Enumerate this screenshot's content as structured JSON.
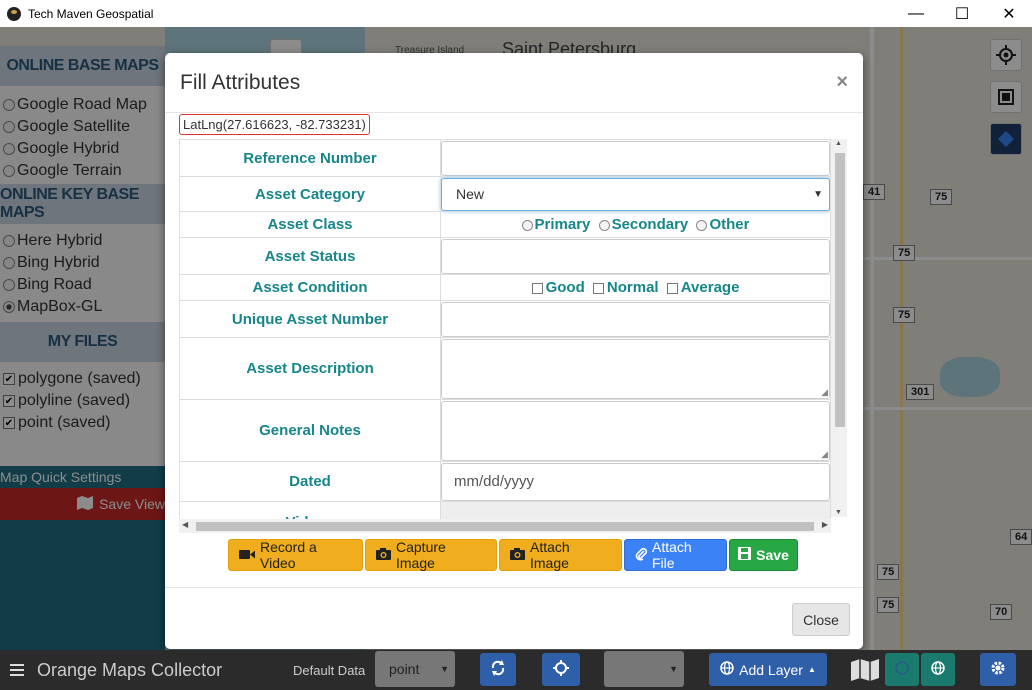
{
  "window": {
    "title": "Tech Maven Geospatial",
    "minimize_glyph": "—",
    "maximize_glyph": "☐",
    "close_glyph": "✕"
  },
  "map": {
    "labels": [
      "Treasure Island",
      "Saint Petersburg"
    ],
    "shields": [
      "41",
      "75",
      "75",
      "75",
      "301",
      "64",
      "75",
      "75",
      "70"
    ]
  },
  "left_panel": {
    "online_base_maps_header": "ONLINE BASE MAPS",
    "base_maps": [
      {
        "label": "Google Road Map",
        "selected": false
      },
      {
        "label": "Google Satellite",
        "selected": false
      },
      {
        "label": "Google Hybrid",
        "selected": false
      },
      {
        "label": "Google Terrain",
        "selected": false
      }
    ],
    "online_key_header": "ONLINE KEY BASE MAPS",
    "key_maps": [
      {
        "label": "Here Hybrid",
        "selected": false
      },
      {
        "label": "Bing Hybrid",
        "selected": false
      },
      {
        "label": "Bing Road",
        "selected": false
      },
      {
        "label": "MapBox-GL",
        "selected": true
      }
    ],
    "my_files_header": "MY FILES",
    "files": [
      {
        "label": "polygone (saved)",
        "checked": true
      },
      {
        "label": "polyline (saved)",
        "checked": true
      },
      {
        "label": "point (saved)",
        "checked": true
      }
    ],
    "quick_settings": "Map Quick Settings",
    "save_view": "Save View"
  },
  "modal": {
    "title": "Fill Attributes",
    "close_glyph": "×",
    "latlng": "LatLng(27.616623, -82.733231)",
    "fields": {
      "reference_number": "Reference Number",
      "asset_category": "Asset Category",
      "asset_category_value": "New",
      "asset_class": "Asset Class",
      "asset_class_options": [
        "Primary",
        "Secondary",
        "Other"
      ],
      "asset_status": "Asset Status",
      "asset_condition": "Asset Condition",
      "asset_condition_options": [
        "Good",
        "Normal",
        "Average"
      ],
      "unique_asset_number": "Unique Asset Number",
      "asset_description": "Asset Description",
      "general_notes": "General Notes",
      "dated": "Dated",
      "dated_placeholder": "mm/dd/yyyy",
      "videos": "Videos"
    },
    "buttons": {
      "record_video": "Record a Video",
      "capture_image": "Capture Image",
      "attach_image": "Attach Image",
      "attach_file": "Attach File",
      "save": "Save",
      "close": "Close"
    }
  },
  "bottom_bar": {
    "app_name": "Orange Maps Collector",
    "default_data_label": "Default Data",
    "default_data_value": "point",
    "add_layer": "Add Layer"
  },
  "colors": {
    "label_teal": "#17868a",
    "warn": "#f0ad1e",
    "primary": "#3b82f6",
    "success": "#28a745",
    "panel_header": "#c9d6e3",
    "save_view_red": "#c62828",
    "teal_panel": "#1f6e84"
  }
}
